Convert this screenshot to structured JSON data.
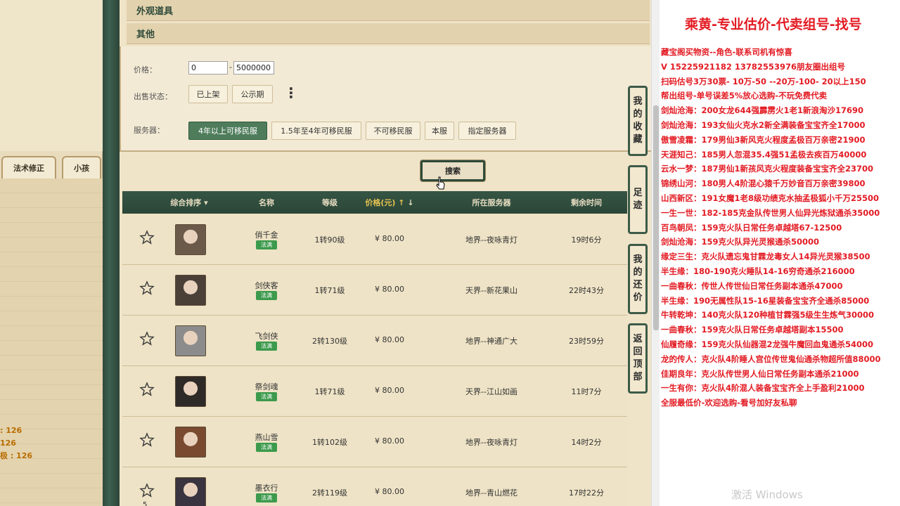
{
  "left_panel": {
    "tabs": [
      "法术修正",
      "小孩"
    ],
    "stats": [
      ": 126",
      "126",
      "极 : 126"
    ]
  },
  "main": {
    "categories": [
      "外观道具",
      "其他"
    ],
    "filters": {
      "price_label": "价格：",
      "price_min": "0",
      "price_dash": "-",
      "price_max": "5000000",
      "status_label": "出售状态：",
      "status_options": [
        "已上架",
        "公示期"
      ],
      "server_label": "服务器：",
      "server_options": [
        "4年以上可移民服",
        "1.5年至4年可移民服",
        "不可移民服",
        "本服",
        "指定服务器"
      ]
    },
    "search_label": "搜索",
    "table": {
      "headers": [
        "综合排序",
        "名称",
        "等级",
        "价格(元)",
        "所在服务器",
        "剩余时间"
      ],
      "rows": [
        {
          "name": "俏千金",
          "badge": "法满",
          "level": "1转90级",
          "price": "¥ 80.00",
          "server": "地界--夜咏青灯",
          "time": "19时6分",
          "fav": ""
        },
        {
          "name": "剑侠客",
          "badge": "法满",
          "level": "1转71级",
          "price": "¥ 80.00",
          "server": "天界--新花果山",
          "time": "22时43分",
          "fav": ""
        },
        {
          "name": "飞剑侠",
          "badge": "法满",
          "level": "2转130级",
          "price": "¥ 80.00",
          "server": "地界--神通广大",
          "time": "23时59分",
          "fav": ""
        },
        {
          "name": "祭剑魂",
          "badge": "法满",
          "level": "1转71级",
          "price": "¥ 80.00",
          "server": "天界--江山如画",
          "time": "11时7分",
          "fav": ""
        },
        {
          "name": "燕山雪",
          "badge": "法满",
          "level": "1转102级",
          "price": "¥ 80.00",
          "server": "地界--夜咏青灯",
          "time": "14时2分",
          "fav": ""
        },
        {
          "name": "墨衣行",
          "badge": "法满",
          "level": "2转119级",
          "price": "¥ 80.00",
          "server": "地界--青山燃花",
          "time": "17时22分",
          "fav": "5"
        }
      ]
    },
    "side_tabs": [
      "我的收藏",
      "足迹",
      "我的还价",
      "返回顶部"
    ]
  },
  "ad": {
    "title": "乘黄-专业估价-代卖组号-找号",
    "lines": [
      "藏宝阁买物资--角色-联系司机有惊喜",
      "V 15225921182  13782553976朋友圈出组号",
      "扫码估号3万30票- 10万-50 --20万-100- 20以上150",
      "帮出组号-单号误差5%放心选购-不玩免费代卖",
      "剑灿沧海：200女龙644强霹雳火1老1新浪淘沙17690",
      "剑灿沧海：193女仙火克水2新全满装备宝宝齐全17000",
      "傲雪凌霜：179男仙3新风克火程度孟极百万亲密21900",
      "天涯知己：185男人忽混35.4强51孟极去疾百万40000",
      "云水一梦：187男仙1新孩风克火程度装备宝宝齐全23700",
      "锦绣山河：180男人4阶混心猿千万妙音百万亲密39800",
      "山西新区：191女魔1老8级功绩克水抽孟极狐小千万25500",
      "一生一世：182-185克金队传世男人仙异光炼狱通杀35000",
      "百鸟朝凤：159克火队日常任务卓越塔67-12500",
      "剑灿沧海：159克火队异光灵猴通杀50000",
      "缘定三生：克火队遗忘鬼甘霖龙毒女人14异光灵猴38500",
      "半生缘：180-190克火睡队14-16穷奇通杀216000",
      "一曲春秋：传世人传世仙日常任务副本通杀47000",
      "半生缘：190无属性队15-16星装备宝宝齐全通杀85000",
      "牛转乾坤：140克火队120种植甘霖强5级生生炼气30000",
      "一曲春秋：159克火队日常任务卓越塔副本15500",
      "仙履奇缘：159克火队仙器混2龙强牛魔回血鬼通杀54000",
      "龙的传人：克火队4阶睡人宫位传世鬼仙通杀物超所值88000",
      "佳期良年：克火队传世男人仙日常任务副本通杀21000",
      "一生有你：克火队4阶混人装备宝宝齐全上手盈利21000",
      "全服最低价-欢迎选购-看号加好友私聊"
    ]
  },
  "watermark": "激活 Windows",
  "colors": {
    "accent_green": "#4f7d5c",
    "dark_green": "#2f4a3a",
    "ad_red": "#e31b23",
    "price_gold": "#e7c34f"
  }
}
